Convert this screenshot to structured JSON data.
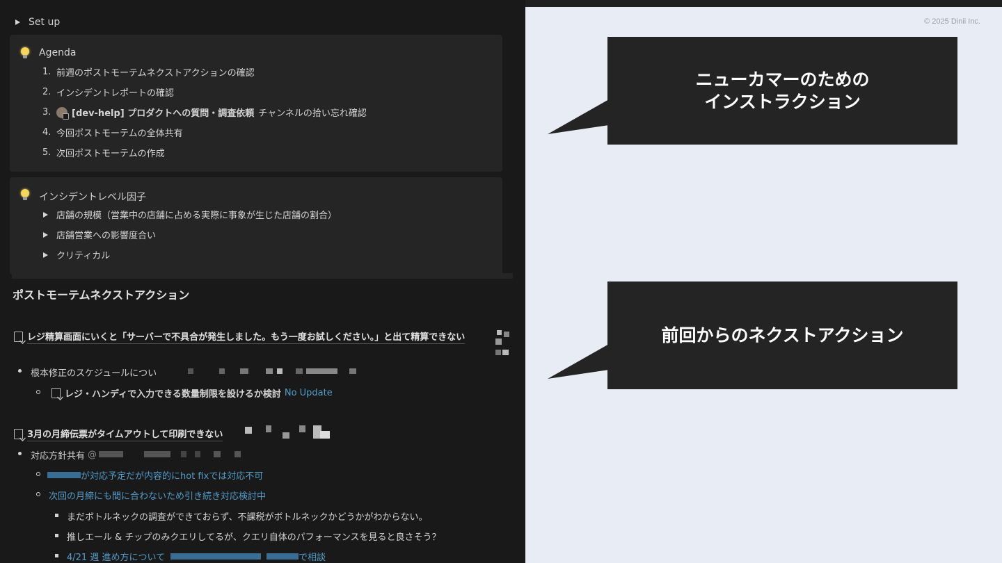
{
  "left": {
    "setup_toggle": "Set up",
    "agenda": {
      "title": "Agenda",
      "items": [
        {
          "num": "1.",
          "text": "前週のポストモーテムネクストアクションの確認"
        },
        {
          "num": "2.",
          "text": "インシデントレポートの確認"
        },
        {
          "num": "3.",
          "channel": "[dev-help] プロダクトへの質問・調査依頼",
          "text": "チャンネルの拾い忘れ確認"
        },
        {
          "num": "4.",
          "text": "今回ポストモーテムの全体共有"
        },
        {
          "num": "5.",
          "text": "次回ポストモーテムの作成"
        }
      ]
    },
    "factors": {
      "title": "インシデントレベル因子",
      "items": [
        "店舗の規模（営業中の店舗に占める実際に事象が生じた店舗の割合）",
        "店舗営業への影響度合い",
        "クリティカル"
      ]
    },
    "heading": "ポストモーテムネクストアクション",
    "issue1": {
      "title": "レジ精算画面にいくと「サーバーで不具合が発生しました。もう一度お試しください。」と出て精算できない",
      "bullet": "根本修正のスケジュールについ",
      "sub_link": "レジ・ハンディで入力できる数量制限を設けるか検討",
      "sub_status": "No Update"
    },
    "issue2": {
      "title": "3月の月締伝票がタイムアウトして印刷できない",
      "bullet": "対応方針共有",
      "bullet_at": "@",
      "sub1": "が対応予定だが内容的にhot fixでは対応不可",
      "sub2": "次回の月締にも間に合わないため引き続き対応検討中",
      "sub2_items": [
        "まだボトルネックの調査ができておらず、不課税がボトルネックかどうかがわからない。",
        "推しエール & チップのみクエリしてるが、クエリ自体のパフォーマンスを見ると良さそう？"
      ],
      "last_item_prefix": "4/21 週  進め方について",
      "last_item_suffix": "で相談"
    }
  },
  "right": {
    "copyright": "© 2025 Dinii Inc.",
    "callout1": "ニューカマーのための\nインストラクション",
    "callout2": "前回からのネクストアクション",
    "box_color": "#242424",
    "bg_color": "#e8edf5"
  }
}
